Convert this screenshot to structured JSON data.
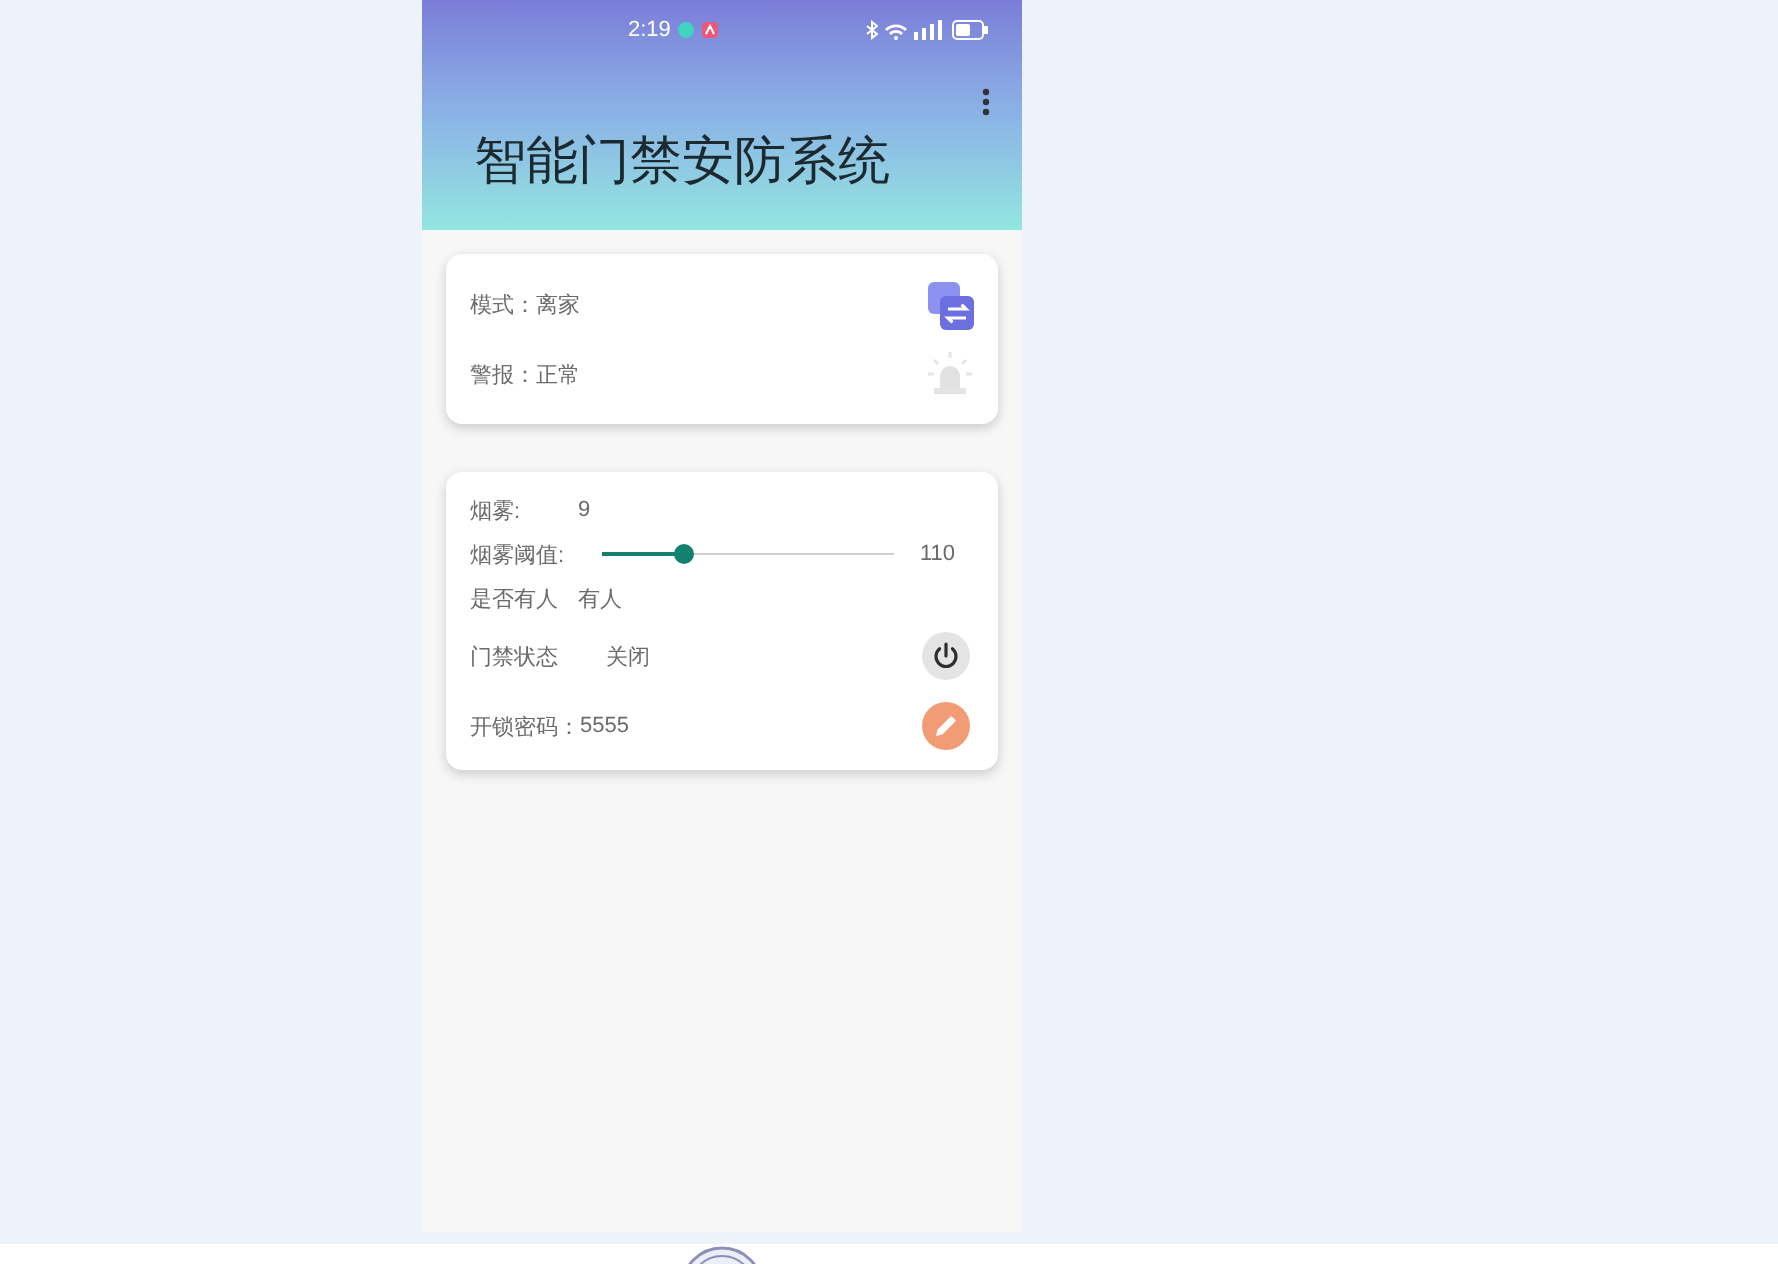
{
  "status_bar": {
    "time": "2:19"
  },
  "app_bar": {
    "title": "智能门禁安防系统"
  },
  "status_card": {
    "rows": [
      {
        "kind": "mode",
        "label": "模式：",
        "value": "离家"
      },
      {
        "kind": "alarm",
        "label": "警报：",
        "value": "正常"
      }
    ]
  },
  "sensor_card": {
    "rows": [
      {
        "kind": "reading",
        "label": "烟雾:",
        "value": "9"
      },
      {
        "kind": "slider",
        "label": "烟雾阈值:",
        "level": 0.28,
        "reading": "110"
      },
      {
        "kind": "reading",
        "label": "是否有人",
        "value": "有人"
      },
      {
        "kind": "door",
        "label": "门禁状态",
        "value": "关闭"
      },
      {
        "kind": "password",
        "label": "开锁密码：",
        "value": "5555"
      }
    ]
  }
}
